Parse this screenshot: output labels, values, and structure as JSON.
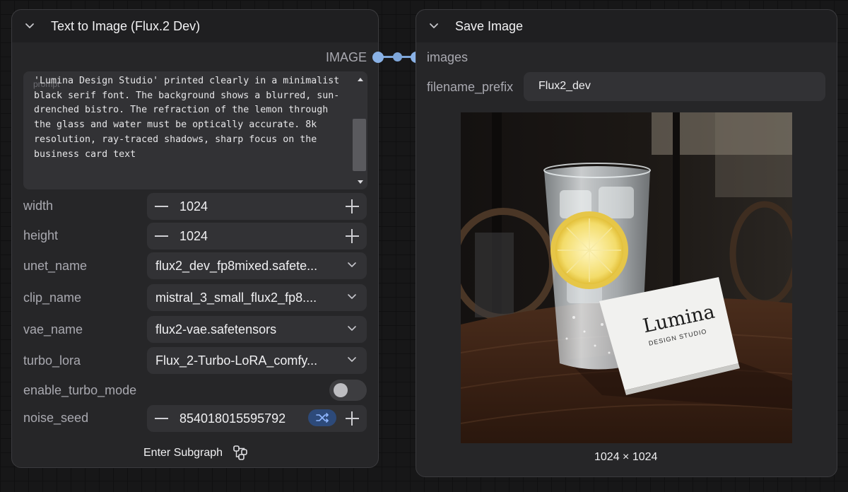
{
  "node_text_to_image": {
    "title": "Text to Image (Flux.2 Dev)",
    "output_port_label": "IMAGE",
    "prompt": {
      "placeholder": "prompt",
      "text": "card leans against the base of the glass with the text 'Lumina Design Studio' printed clearly in a minimalist black serif font. The background shows a blurred, sun-drenched bistro. The refraction of the lemon through the glass and water must be optically accurate. 8k resolution, ray-traced shadows, sharp focus on the business card text"
    },
    "width": {
      "label": "width",
      "value": "1024"
    },
    "height": {
      "label": "height",
      "value": "1024"
    },
    "unet_name": {
      "label": "unet_name",
      "value": "flux2_dev_fp8mixed.safete..."
    },
    "clip_name": {
      "label": "clip_name",
      "value": "mistral_3_small_flux2_fp8...."
    },
    "vae_name": {
      "label": "vae_name",
      "value": "flux2-vae.safetensors"
    },
    "turbo_lora": {
      "label": "turbo_lora",
      "value": "Flux_2-Turbo-LoRA_comfy..."
    },
    "enable_turbo_mode": {
      "label": "enable_turbo_mode",
      "enabled": false
    },
    "noise_seed": {
      "label": "noise_seed",
      "value": "854018015595792",
      "randomize_icon": "shuffle-icon"
    },
    "enter_subgraph_label": "Enter Subgraph"
  },
  "node_save_image": {
    "title": "Save Image",
    "input_port_label": "images",
    "filename_prefix": {
      "label": "filename_prefix",
      "value": "Flux2_dev"
    },
    "preview": {
      "card_title": "Lumina",
      "card_subtitle": "DESIGN STUDIO",
      "dimensions": "1024 × 1024"
    }
  },
  "colors": {
    "canvas_bg": "#171718",
    "node_bg": "#262628",
    "widget_bg": "#323235",
    "link_color": "#7ea6d9",
    "seed_toggle_bg": "#2d4a7a"
  }
}
